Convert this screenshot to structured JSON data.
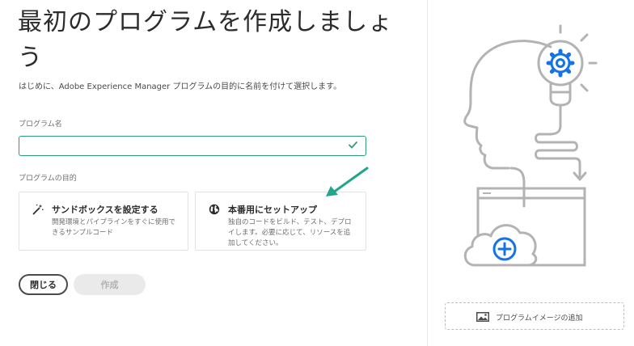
{
  "header": {
    "title": "最初のプログラムを作成しましょう",
    "subtitle": "はじめに、Adobe Experience Manager プログラムの目的に名前を付けて選択します。"
  },
  "form": {
    "program_name_label": "プログラム名",
    "program_name_value": "",
    "program_name_valid": true,
    "purpose_label": "プログラムの目的"
  },
  "purpose_options": [
    {
      "title": "サンドボックスを設定する",
      "description": "開発環境とパイプラインをすぐに使用できるサンプルコード",
      "icon": "magic-wand-icon"
    },
    {
      "title": "本番用にセットアップ",
      "description": "独自のコードをビルド、テスト、デプロイします。必要に応じて、リソースを追加してください。",
      "icon": "globe-icon"
    }
  ],
  "actions": {
    "close_label": "閉じる",
    "create_label": "作成",
    "create_enabled": false
  },
  "image_panel": {
    "add_image_label": "プログラムイメージの追加",
    "icon": "image-icon"
  },
  "colors": {
    "accent_green": "#2d9d78",
    "arrow_teal": "#23a58d",
    "illustration_blue": "#1473e6",
    "illustration_gray": "#b3b3b3"
  }
}
